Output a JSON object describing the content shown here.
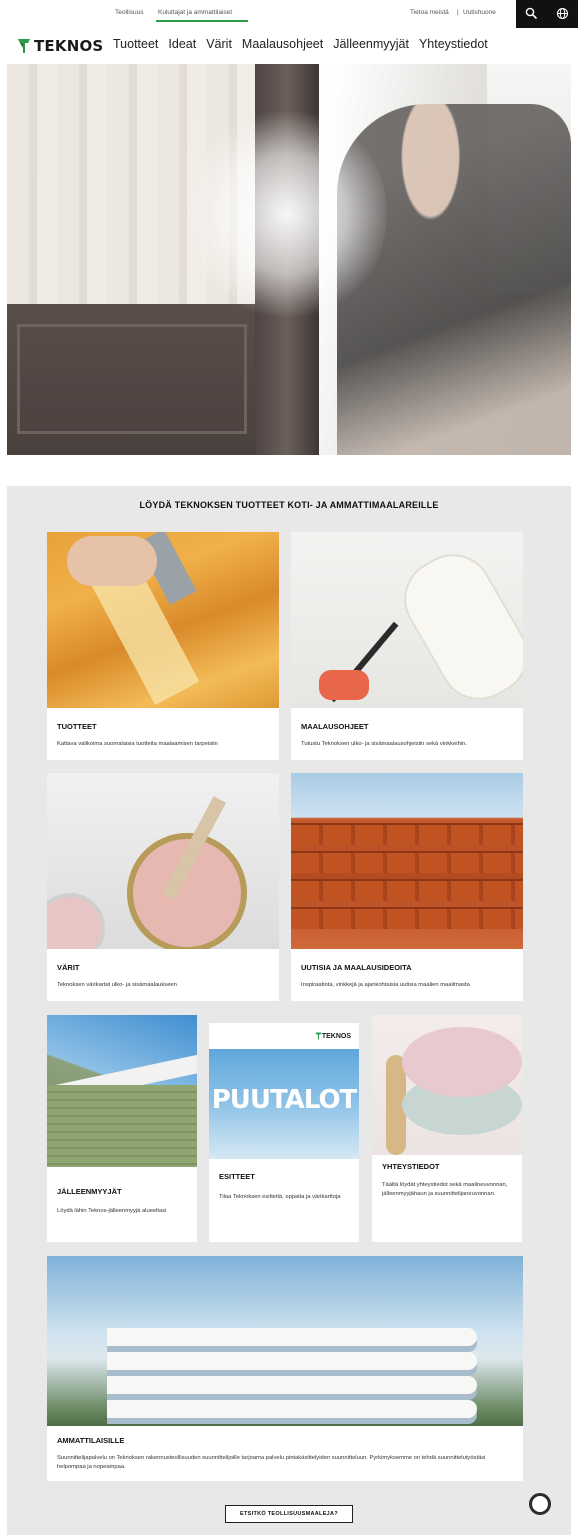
{
  "topbar": {
    "industry": "Teollisuus",
    "consumer": "Kuluttajat ja ammattilaiset",
    "about": "Tietoa meistä",
    "separator": "|",
    "newsroom": "Uutishuone"
  },
  "brand": {
    "name": "TEKNOS",
    "accent": "#2e9b4a"
  },
  "nav": {
    "items": [
      "Tuotteet",
      "Ideat",
      "Värit",
      "Maalausohjeet",
      "Jälleenmyyjät",
      "Yhteystiedot"
    ]
  },
  "section": {
    "title": "LÖYDÄ TEKNOKSEN TUOTTEET KOTI- JA AMMATTIMAALAREILLE",
    "cards": [
      {
        "title": "TUOTTEET",
        "desc": "Kattava valikoima suomalaisia tuotteita maalaamisen tarpeisiin"
      },
      {
        "title": "MAALAUSOHJEET",
        "desc": "Tutustu Teknoksen ulko- ja sisämaalausohjeisiin sekä vinkkeihin."
      },
      {
        "title": "VÄRIT",
        "desc": "Teknoksen värikartat ulko- ja sisämaalaukseen"
      },
      {
        "title": "UUTISIA JA MAALAUSIDEOITA",
        "desc": "Inspiraatiota, vinkkejä ja ajankohtaisia uutisia maalien maailmasta"
      },
      {
        "title": "JÄLLEENMYYJÄT",
        "desc": "Löydä lähin Teknos-jälleenmyyjä alueeltasi"
      },
      {
        "title": "ESITTEET",
        "desc": "Tilaa Teknoksen esitteitä, oppaita ja värikarttoja"
      },
      {
        "title": "YHTEYSTIEDOT",
        "desc": "Täältä löydät yhteystiedot sekä maalineuvonnan, jälleenmyyjähaun ja suunnittelijaneuvonnan."
      },
      {
        "title": "AMMATTILAISILLE",
        "desc": "Suunnittelijapalvelu on Teknoksen rakennusteollisuuden suunnittelijoille tarjoama palvelu pintakäsittelyiden suunnitteluun. Pyrkimyksemme on tehdä suunnittelutyöstäsi helpompaa ja nopeampaa."
      }
    ],
    "brochure_word": "PUUTALOT",
    "brochure_logo": "TEKNOS",
    "cta": "ETSITKÖ TEOLLISUUSMAALEJA?"
  },
  "icons": {
    "search": "search-icon",
    "globe": "globe-icon",
    "chat": "chat-icon",
    "logo": "teknos-logo-icon"
  }
}
